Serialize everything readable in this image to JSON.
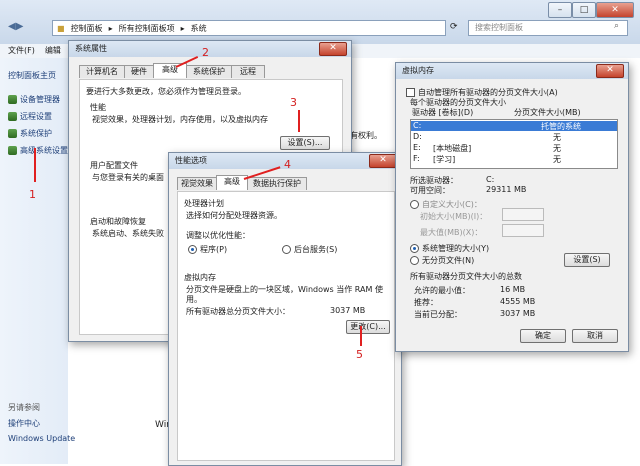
{
  "explorer": {
    "breadcrumb": [
      "控制面板",
      "所有控制面板项",
      "系统"
    ],
    "search_placeholder": "搜索控制面板",
    "menu": [
      "文件(F)",
      "编辑"
    ],
    "sidebar": [
      "控制面板主页",
      "设备管理器",
      "远程设置",
      "系统保护",
      "高级系统设置"
    ],
    "see_also": "另请参阅",
    "action_center": "操作中心",
    "windows_update": "Windows Update",
    "partial_text": "Win",
    "rights_fragment": "有权利。"
  },
  "sysprops": {
    "title": "系统属性",
    "tabs": [
      "计算机名",
      "硬件",
      "高级",
      "系统保护",
      "远程"
    ],
    "admin_note": "要进行大多数更改，您必须作为管理员登录。",
    "perf_heading": "性能",
    "perf_desc": "视觉效果，处理器计划，内存使用，以及虚拟内存",
    "settings_btn": "设置(S)...",
    "profile_heading": "用户配置文件",
    "profile_desc": "与您登录有关的桌面",
    "startup_heading": "启动和故障恢复",
    "startup_desc": "系统启动、系统失败"
  },
  "perfopts": {
    "title": "性能选项",
    "tabs": [
      "视觉效果",
      "高级",
      "数据执行保护"
    ],
    "sched_heading": "处理器计划",
    "sched_desc": "选择如何分配处理器资源。",
    "optimize_label": "调整以优化性能：",
    "opt_programs": "程序(P)",
    "opt_background": "后台服务(S)",
    "vm_heading": "虚拟内存",
    "vm_desc_1": "分页文件是硬盘上的一块区域，Windows 当作 RAM 使",
    "vm_desc_2": "用。",
    "vm_total_label": "所有驱动器总分页文件大小：",
    "vm_total_value": "3037 MB",
    "change_btn": "更改(C)..."
  },
  "vm": {
    "title": "虚拟内存",
    "auto_manage": "自动管理所有驱动器的分页文件大小(A)",
    "per_drive": "每个驱动器的分页文件大小",
    "col_drive": "驱动器 [卷标](D)",
    "col_size": "分页文件大小(MB)",
    "drives": [
      {
        "drive": "C:",
        "label": "",
        "size": "托管的系统"
      },
      {
        "drive": "D:",
        "label": "",
        "size": "无"
      },
      {
        "drive": "E:",
        "label": "[本地磁盘]",
        "size": "无"
      },
      {
        "drive": "F:",
        "label": "[学习]",
        "size": "无"
      }
    ],
    "sel_drive_label": "所选驱动器：",
    "sel_drive_value": "C:",
    "free_label": "可用空间：",
    "free_value": "29311 MB",
    "custom_size": "自定义大小(C)：",
    "initial_size": "初始大小(MB)(I)：",
    "max_size": "最大值(MB)(X)：",
    "system_managed": "系统管理的大小(Y)",
    "no_paging": "无分页文件(N)",
    "set_btn": "设置(S)",
    "totals_heading": "所有驱动器分页文件大小的总数",
    "min_label": "允许的最小值：",
    "min_value": "16 MB",
    "rec_label": "推荐：",
    "rec_value": "4555 MB",
    "cur_label": "当前已分配：",
    "cur_value": "3037 MB",
    "ok_btn": "确定",
    "cancel_btn": "取消"
  },
  "annotations": [
    "1",
    "2",
    "3",
    "4",
    "5"
  ],
  "colors": {
    "annotation": "#e02020",
    "selection": "#3a7bd5"
  }
}
